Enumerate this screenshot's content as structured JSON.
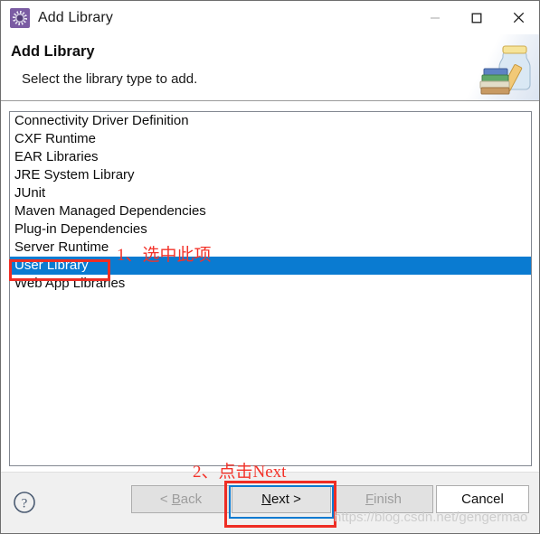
{
  "window": {
    "title": "Add Library",
    "icon": "eclipse-library-icon",
    "controls": {
      "minimize": "minimize",
      "maximize": "maximize",
      "close": "close"
    }
  },
  "header": {
    "title": "Add Library",
    "subtitle": "Select the library type to add.",
    "art": "jar-with-books-icon"
  },
  "list": {
    "items": [
      {
        "label": "Connectivity Driver Definition",
        "selected": false
      },
      {
        "label": "CXF Runtime",
        "selected": false
      },
      {
        "label": "EAR Libraries",
        "selected": false
      },
      {
        "label": "JRE System Library",
        "selected": false
      },
      {
        "label": "JUnit",
        "selected": false
      },
      {
        "label": "Maven Managed Dependencies",
        "selected": false
      },
      {
        "label": "Plug-in Dependencies",
        "selected": false
      },
      {
        "label": "Server Runtime",
        "selected": false
      },
      {
        "label": "User Library",
        "selected": true
      },
      {
        "label": "Web App Libraries",
        "selected": false
      }
    ]
  },
  "footer": {
    "help": "help-icon",
    "buttons": {
      "back": {
        "label": "< Back",
        "mnemonic": "B",
        "enabled": false
      },
      "next": {
        "label": "Next >",
        "mnemonic": "N",
        "enabled": true,
        "focused": true
      },
      "finish": {
        "label": "Finish",
        "mnemonic": "F",
        "enabled": false
      },
      "cancel": {
        "label": "Cancel",
        "enabled": true
      }
    }
  },
  "annotations": {
    "step1": "1、选中此项",
    "step2": "2、点击Next",
    "highlight_color": "#ee2d24"
  },
  "watermark": "https://blog.csdn.net/gengermao",
  "colors": {
    "selection_blue": "#0a7bd1",
    "titlebar_bg": "#ffffff",
    "footer_bg": "#f0f0f0",
    "annotation_red": "#ee2d24",
    "icon_purple": "#7b5ca3"
  }
}
